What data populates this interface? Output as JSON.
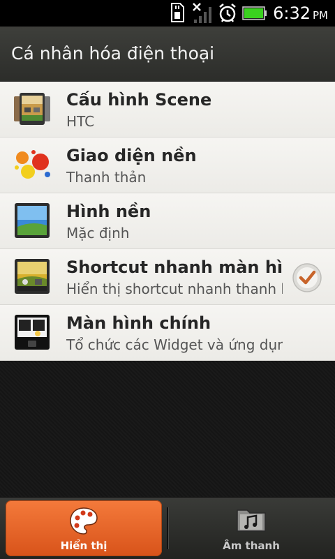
{
  "status_bar": {
    "time": "6:32",
    "ampm": "PM",
    "icons": [
      "sd-card-icon",
      "no-signal-icon",
      "alarm-icon",
      "battery-icon"
    ]
  },
  "header": {
    "title": "Cá nhân hóa điện thoại"
  },
  "list": {
    "items": [
      {
        "title": "Cấu hình Scene",
        "subtitle": "HTC",
        "icon": "scene-icon"
      },
      {
        "title": "Giao diện nền",
        "subtitle": "Thanh thản",
        "icon": "skin-icon"
      },
      {
        "title": "Hình nền",
        "subtitle": "Mặc định",
        "icon": "wallpaper-icon"
      },
      {
        "title": "Shortcut nhanh màn hình khóa",
        "subtitle": "Hiển thị shortcut nhanh thanh khóa",
        "icon": "lockscreen-shortcut-icon",
        "checked": true
      },
      {
        "title": "Màn hình chính",
        "subtitle": "Tổ chức các Widget và ứng dụng",
        "icon": "home-screen-icon"
      }
    ]
  },
  "bottom_tabs": [
    {
      "label": "Hiển thị",
      "icon": "palette-icon",
      "active": true
    },
    {
      "label": "Âm thanh",
      "icon": "music-folder-icon",
      "active": false
    }
  ],
  "colors": {
    "accent": "#e8622a",
    "check": "#c8642a",
    "battery": "#3ad11f"
  }
}
